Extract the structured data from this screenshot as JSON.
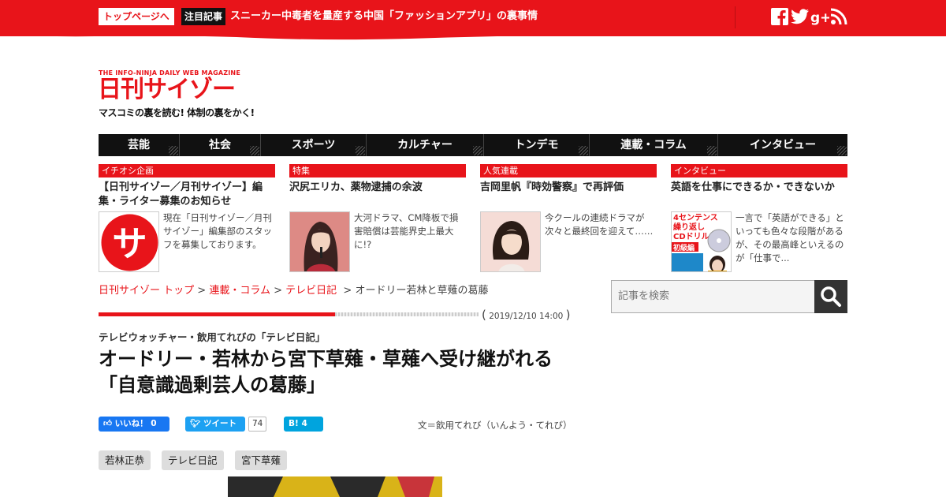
{
  "topbar": {
    "home_button": "トップページへ",
    "highlight_badge": "注目記事",
    "highlight_text": "スニーカー中毒者を量産する中国「ファッションアプリ」の裏事情",
    "social_icons": [
      "facebook-icon",
      "twitter-icon",
      "google-plus-icon",
      "rss-icon"
    ],
    "accent_color": "#e8141a"
  },
  "logo": {
    "subtitle": "THE INFO-NINJA DAILY WEB MAGAZINE",
    "name": "日刊サイゾー",
    "tagline": "マスコミの裏を読む! 体制の裏をかく!"
  },
  "nav": {
    "items": [
      "芸能",
      "社会",
      "スポーツ",
      "カルチャー",
      "トンデモ",
      "連載・コラム",
      "インタビュー"
    ]
  },
  "cards": [
    {
      "tag": "イチオシ企画",
      "title": "【日刊サイゾー／月刊サイゾー】編集・ライター募集のお知らせ",
      "excerpt": "現在「日刊サイゾー／月刊サイゾー」編集部のスタッフを募集しております。",
      "thumb": "サ"
    },
    {
      "tag": "特集",
      "title": "沢尻エリカ、薬物逮捕の余波",
      "excerpt": "大河ドラマ、CM降板で損害賠償は芸能界史上最大に!?"
    },
    {
      "tag": "人気連載",
      "title": "吉岡里帆『時効警察』で再評価",
      "excerpt": "今クールの連続ドラマが次々と最終回を迎えて……"
    },
    {
      "tag": "インタビュー",
      "title": "英語を仕事にできるか・できないか",
      "excerpt": "一言で「英語ができる」といっても色々な段階があるが、その最高峰といえるのが「仕事で...",
      "thumb_lines": [
        "4センテンス",
        "繰り返し",
        "CDドリル",
        "初級編"
      ]
    }
  ],
  "breadcrumb": {
    "home": "日刊サイゾー トップ",
    "sep": ">",
    "section": "連載・コラム",
    "series": "テレビ日記",
    "current": "オードリー若林と草薙の葛藤"
  },
  "search": {
    "placeholder": "記事を検索"
  },
  "article": {
    "date": "2019/12/10 14:00",
    "kicker": "テレビウォッチャー・飲用てれびの「テレビ日記」",
    "headline": "オードリー・若林から宮下草薙・草薙へ受け継がれる「自意識過剰芸人の葛藤」",
    "byline": "文＝飲用てれび（いんよう・てれび）",
    "share": {
      "like_label": "いいね！",
      "like_count": "0",
      "tweet_label": "ツイート",
      "tweet_count": "74",
      "hatena_label": "B!",
      "hatena_count": "4"
    },
    "tags": [
      "若林正恭",
      "テレビ日記",
      "宮下草薙"
    ]
  }
}
